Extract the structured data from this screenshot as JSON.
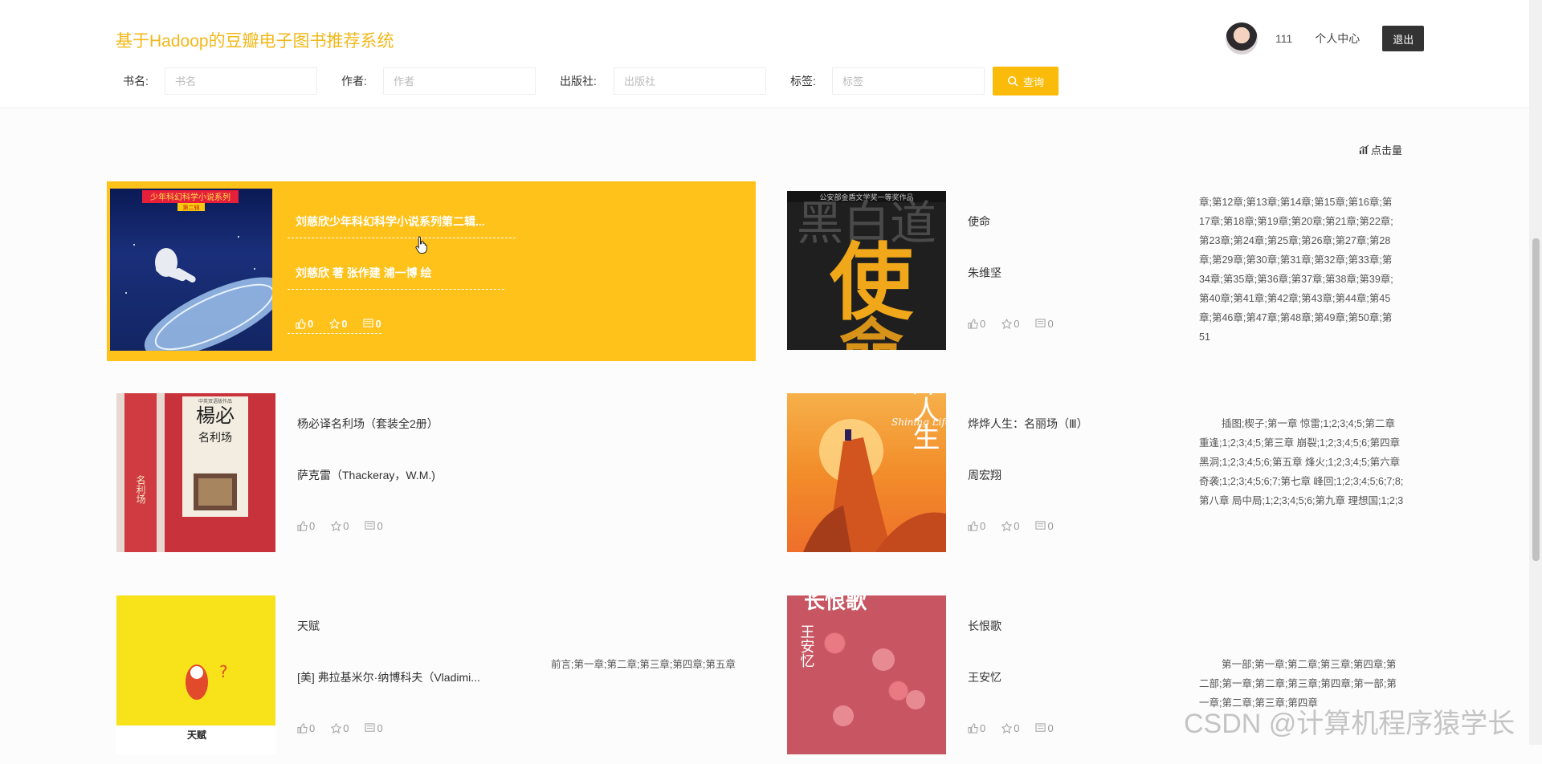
{
  "header": {
    "site_title": "基于Hadoop的豆瓣电子图书推荐系统",
    "username": "111",
    "personal_center": "个人中心",
    "logout": "退出"
  },
  "search": {
    "name_label": "书名:",
    "name_placeholder": "书名",
    "author_label": "作者:",
    "author_placeholder": "作者",
    "publisher_label": "出版社:",
    "publisher_placeholder": "出版社",
    "tag_label": "标签:",
    "tag_placeholder": "标签",
    "query_button": "查询"
  },
  "sort": {
    "clicks_label": "点击量"
  },
  "books": [
    {
      "title": "刘慈欣少年科幻科学小说系列第二辑...",
      "author": "刘慈欣 著 张作建 浦一博 绘",
      "likes": "0",
      "favorites": "0",
      "comments": "0",
      "desc": ""
    },
    {
      "title": "使命",
      "author": "朱维坚",
      "likes": "0",
      "favorites": "0",
      "comments": "0",
      "desc": "章;第12章;第13章;第14章;第15章;第16章;第17章;第18章;第19章;第20章;第21章;第22章;第23章;第24章;第25章;第26章;第27章;第28章;第29章;第30章;第31章;第32章;第33章;第34章;第35章;第36章;第37章;第38章;第39章;第40章;第41章;第42章;第43章;第44章;第45章;第46章;第47章;第48章;第49章;第50章;第51"
    },
    {
      "title": "杨必译名利场（套装全2册）",
      "author": "萨克雷（Thackeray，W.M.)",
      "likes": "0",
      "favorites": "0",
      "comments": "0",
      "desc": ""
    },
    {
      "title": "烨烨人生：名丽场（Ⅲ）",
      "author": "周宏翔",
      "likes": "0",
      "favorites": "0",
      "comments": "0",
      "desc": "插图;楔子;第一章 惊雷;1;2;3;4;5;第二章 重逢;1;2;3;4;5;第三章 崩裂;1;2;3;4;5;6;第四章 黑洞;1;2;3;4;5;6;第五章 烽火;1;2;3;4;5;第六章 奇袭;1;2;3;4;5;6;7;第七章 峰回;1;2;3;4;5;6;7;8;第八章 局中局;1;2;3;4;5;6;第九章 理想国;1;2;3"
    },
    {
      "title": "天赋",
      "author": "[美] 弗拉基米尔·纳博科夫（Vladimi...",
      "likes": "0",
      "favorites": "0",
      "comments": "0",
      "desc": "前言;第一章;第二章;第三章;第四章;第五章"
    },
    {
      "title": "长恨歌",
      "author": "王安忆",
      "likes": "0",
      "favorites": "0",
      "comments": "0",
      "desc": "第一部;第一章;第二章;第三章;第四章;第二部;第一章;第二章;第三章;第四章;第一部;第一章;第二章;第三章;第四章"
    }
  ],
  "covers": {
    "book0": {
      "series_text": "少年科幻科学小说系列",
      "tag": "第二辑"
    },
    "book1": {
      "big_char": "使",
      "band_text": "公安部金盾文学奖一等奖作品",
      "top_text": "黑白道",
      "bottom_char": "命"
    },
    "book2": {
      "top_text": "中英双语版作品",
      "title_text": "楊必",
      "subtitle": "名利场",
      "spine_text": "名利场"
    },
    "book3": {
      "vertical_text": "烨人生",
      "script_text": "Shining Life"
    },
    "book4": {
      "caption": "天赋"
    },
    "book5": {
      "title_text": "长恨歌",
      "author_text": "王安忆"
    }
  },
  "watermark": "CSDN @计算机程序猿学长",
  "colors": {
    "accent": "#ffc21a",
    "title": "#f2b81a",
    "query": "#fbbb0a"
  }
}
